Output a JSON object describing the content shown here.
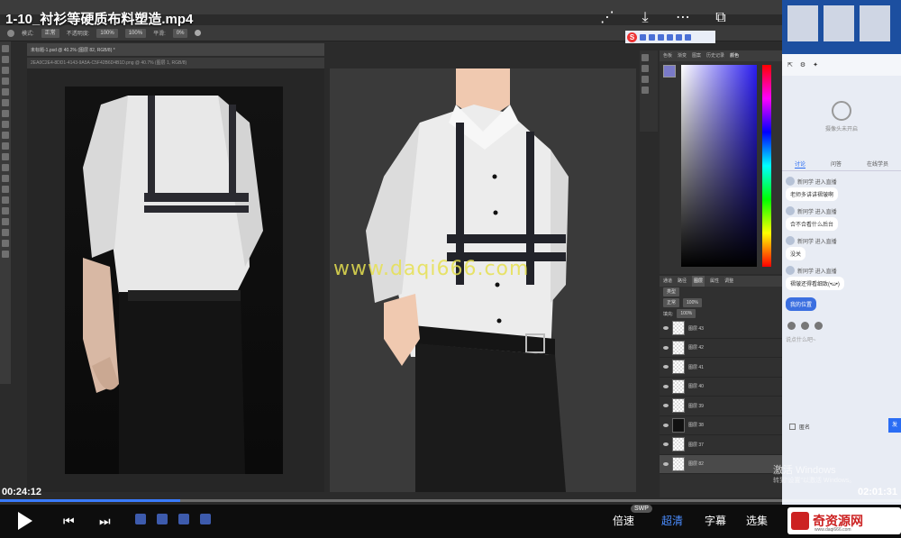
{
  "video": {
    "title": "1-10_衬衫等硬质布料塑造.mp4",
    "current_time": "00:24:12",
    "total_time": "02:01:31",
    "progress_fraction": 0.2,
    "controls": {
      "speed": "倍速",
      "quality": "超清",
      "subtitle": "字幕",
      "episodes": "选集",
      "swp": "SWP"
    }
  },
  "watermark": "www.daqi666.com",
  "photoshop": {
    "doc_tab": "未标题-1.psd @ 40.2% (图层 82, RGB/8) *",
    "ref_tab": "2EA0C2E4-8DD1-4143-9A5A-C5F42B6D4B1D.png @ 40.7% (图层 1, RGB/8)",
    "options": {
      "mode_label": "模式:",
      "mode_value": "正常",
      "opacity_label": "不透明度:",
      "opacity_value": "100%",
      "flow_value": "100%",
      "smooth_label": "平滑:",
      "smooth_value": "0%"
    },
    "color_tabs": [
      "色板",
      "渐变",
      "图案",
      "历史记录",
      "颜色"
    ],
    "layer_tabs": [
      "通道",
      "路径",
      "图层",
      "属性",
      "调整"
    ],
    "layer_kind": "类型",
    "blend_mode": "正常",
    "layer_opacity": "100%",
    "fill_label": "填充:",
    "fill_value": "100%",
    "layers": [
      "图层 43",
      "图层 42",
      "图层 41",
      "图层 40",
      "图层 39",
      "图层 38",
      "图层 37",
      "图层 82"
    ]
  },
  "chat": {
    "cam_text": "摄像头未开启",
    "tabs": [
      "讨论",
      "问答",
      "在线学员"
    ],
    "messages": [
      {
        "who": "新同学 进入直播",
        "text": "老师多讲讲褶皱啊"
      },
      {
        "who": "新同学 进入直播",
        "text": "合不合看什么后台"
      },
      {
        "who": "新同学 进入直播",
        "text": "没关"
      },
      {
        "who": "新同学 进入直播",
        "text": "褶皱还得看细致(•ω•)"
      }
    ],
    "my_position": "我的位置",
    "input_placeholder": "说点什么吧~",
    "anon_label": "匿名",
    "send_label": "发"
  },
  "os": {
    "activate_title": "激活 Windows",
    "activate_sub": "转到\"设置\"以激活 Windows。"
  },
  "site_logo": {
    "name": "奇资源网",
    "url": "www.daqi666.com"
  }
}
